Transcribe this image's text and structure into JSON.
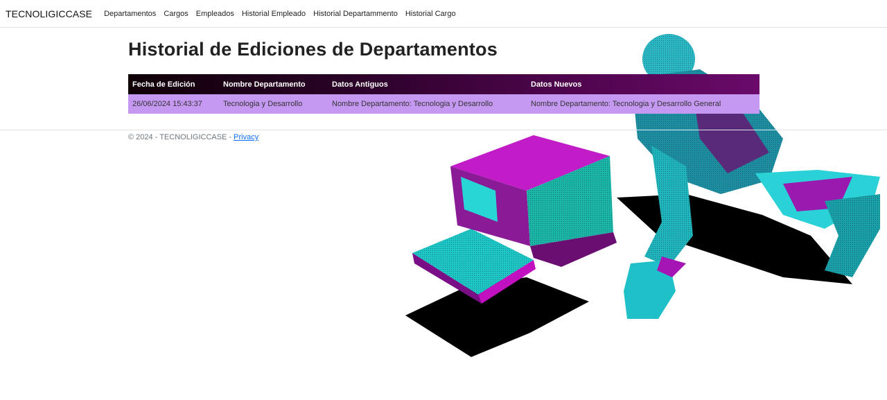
{
  "navbar": {
    "brand": "TECNOLIGICCASE",
    "links": [
      "Departamentos",
      "Cargos",
      "Empleados",
      "Historial Empleado",
      "Historial Departammento",
      "Historial Cargo"
    ]
  },
  "main": {
    "title": "Historial de Ediciones de Departamentos",
    "table": {
      "headers": [
        "Fecha de Edición",
        "Nombre Departamento",
        "Datos Antiguos",
        "Datos Nuevos"
      ],
      "rows": [
        [
          "26/06/2024 15:43:37",
          "Tecnologia y Desarrollo",
          "Nombre Departamento: Tecnologia y Desarrollo",
          "Nombre Departamento: Tecnologia y Desarrollo General"
        ]
      ]
    }
  },
  "footer": {
    "text": "© 2024 - TECNOLIGICCASE - ",
    "privacy": "Privacy"
  },
  "colors": {
    "header_gradient_start": "#0f0006",
    "header_gradient_end": "#6a0a6a",
    "row_bg": "#c598f2",
    "link": "#0d6efd"
  },
  "icons": {
    "background_art": "retro-computer-and-crouching-figure-illustration"
  }
}
